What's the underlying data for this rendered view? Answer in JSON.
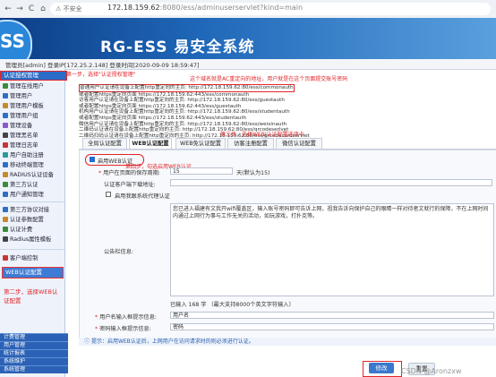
{
  "browser": {
    "back": "←",
    "forward": "→",
    "reload": "C",
    "home": "⌂",
    "insecure": "不安全",
    "url_host": "172.18.159.62",
    "url_rest": ":8080/ess/adminuserservlet?kind=main"
  },
  "header": {
    "logo": "SS",
    "brand": "RG-ESS 易安全系统"
  },
  "userbar": {
    "text": "管理员[admin] 登录IP[172.25.2.148] 登录时间[2020-09-09 18:59:47]"
  },
  "annotations": {
    "step1": "第一步，选择\"认证授权管理\"",
    "step2": "第二步，选择WEB认证配置",
    "step3": "第三步，选择WEBJ认证配置选项卡",
    "step4": "第四步，勾选启用WEB认证",
    "top_note": "这个域名就是AC重定向的地址，用户就是在这个页面提交账号密码"
  },
  "sidebar": {
    "header": "认证授权管理",
    "items": [
      "管理在线用户",
      "管理用户",
      "管理用户模板",
      "管理用户组",
      "管理设备",
      "管理黑名单",
      "管理日志单",
      "用户自助注册",
      "移动终端管理",
      "RADIUS认证设备",
      "第三方认证",
      "用户通知管理"
    ],
    "items2": [
      "第三方协议对接",
      "认证参数配置",
      "认证计费",
      "Radius属性模板"
    ],
    "item3": "客户端控制",
    "active": "WEB认证配置",
    "step2_note_1": "第二步，选择WEB认",
    "step2_note_2": "证配置",
    "bottom": [
      "计费管理",
      "用户管理",
      "统计报表",
      "系统维护",
      "系统管理"
    ]
  },
  "notes": [
    "普通用户认证请在设备上配置http重定向的主页:  http://172.18.159.62:80/ess/commonauth",
    "或者配置https重定向页面 https://172.18.159.62:443/ess/commonauth",
    "访客用户认证请在设备上配置http重定向的主页:  http://172.18.159.62:80/ess/guestauth",
    "或者配置https重定向页面 https://172.18.159.62:443/ess/guestauth",
    "机构用户认证请在设备上配置http重定向的主页:  http://172.18.159.62:80/ess/studentauth",
    "或者配置https重定向页面 https://172.18.159.62:443/ess/studentauth",
    "微信用户认证请在设备上配置http重定向的主页:  http://172.18.159.62:80/ess/weixinauth",
    "二维码认证请在设备上配置http重定向的主页:  http://172.18.159.62:80/ess/qrcodeserlvet",
    "二维码扫码认证请在设备上配置http重定向的主页:  http://172.18.159.62:80/ess/qrcodecardservlet"
  ],
  "tabs": [
    "全局认证配置",
    "WEB认证配置",
    "WEB免认证配置",
    "访客注册配置",
    "微信认证配置"
  ],
  "form": {
    "enable_web_auth": "启用WEB认证",
    "timeout_label": "用户在页面的保存周期:",
    "timeout_value": "15",
    "timeout_unit": "天(默认为15)",
    "login_prompt_label": "认证客户端下载地址:",
    "login_prompt_value": "",
    "proxy_label": "启用我跟系统代理认证",
    "notice_label": "公告栏信息:",
    "notice_text": "您已进入福建有文我开wifi覆盖区，输入账号密码即可告诉上网，祖我告诉向保护自己的眼睛一样对待者文就行的保障，不在上网时间内通过上网行为事与工作无关的活动，如玩游戏，打扑克等。",
    "count_text": "已输入 168 字 （最大支持8000个英文字符输入）",
    "username_label": "用户名输入框提示信息:",
    "username_value": "用户名",
    "password_label": "密码输入框提示信息:",
    "password_value": "密码",
    "hint": "提示：启用WEB认证后，上网用户在访问请求时的则必须进行认证。",
    "modify_button": "修改",
    "reset_button": "重置"
  },
  "watermark": "CSDN @Aronzxw",
  "colors": {
    "header_dark": "#0d3d86",
    "accent": "#2a6cc7",
    "annotation": "#e0262a"
  }
}
